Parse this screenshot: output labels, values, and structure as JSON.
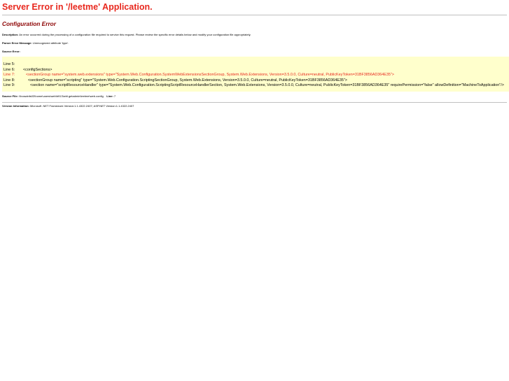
{
  "header": {
    "title": "Server Error in '/leetme' Application."
  },
  "error": {
    "heading": "Configuration Error",
    "description_label": "Description:",
    "description_text": " An error occurred during the processing of a configuration file required to service this request. Please review the specific error details below and modify your configuration file appropriately.",
    "parser_label": "Parser Error Message:",
    "parser_text": " Unrecognized attribute 'type'.",
    "source_label": "Source Error:"
  },
  "source_error": {
    "lines": [
      {
        "number": "Line 5:",
        "code": "",
        "is_error": false
      },
      {
        "number": "Line 6:",
        "code": "<configSections>",
        "indent": 1,
        "is_error": false
      },
      {
        "number": "Line 7:",
        "code": "<sectionGroup name=\"system.web.extensions\" type=\"System.Web.Configuration.SystemWebExtensionsSectionGroup, System.Web.Extensions, Version=3.5.0.0, Culture=neutral, PublicKeyToken=31BF3856AD364E35\">",
        "indent": 2,
        "is_error": true
      },
      {
        "number": "Line 8:",
        "code": "<sectionGroup name=\"scripting\" type=\"System.Web.Configuration.ScriptingSectionGroup, System.Web.Extensions, Version=3.5.0.0, Culture=neutral, PublicKeyToken=31BF3856AD364E35\">",
        "indent": 3,
        "is_error": false
      },
      {
        "number": "Line 9:",
        "code": "<section name=\"scriptResourceHandler\" type=\"System.Web.Configuration.ScriptingScriptResourceHandlerSection, System.Web.Extensions, Version=3.5.0.0, Culture=neutral, PublicKeyToken=31BF3856AD364E35\" requirePermission=\"false\" allowDefinition=\"MachineToApplication\"/>",
        "indent": 4,
        "is_error": false
      }
    ]
  },
  "source_file": {
    "label": "Source File:",
    "path": " \\\\boswinfs03\\home\\users\\web\\b913\\whl.getadmin\\leetme\\web.config",
    "line_label": "Line:",
    "line_value": " 7"
  },
  "version": {
    "label": "Version Information:",
    "text": " Microsoft .NET Framework Version:1.1.4322.2407; ASP.NET Version:1.1.4322.2407"
  },
  "colors": {
    "title": "#e8281e",
    "heading": "#8b0000",
    "code_background": "#ffffcc",
    "error_line": "#e8281e"
  }
}
